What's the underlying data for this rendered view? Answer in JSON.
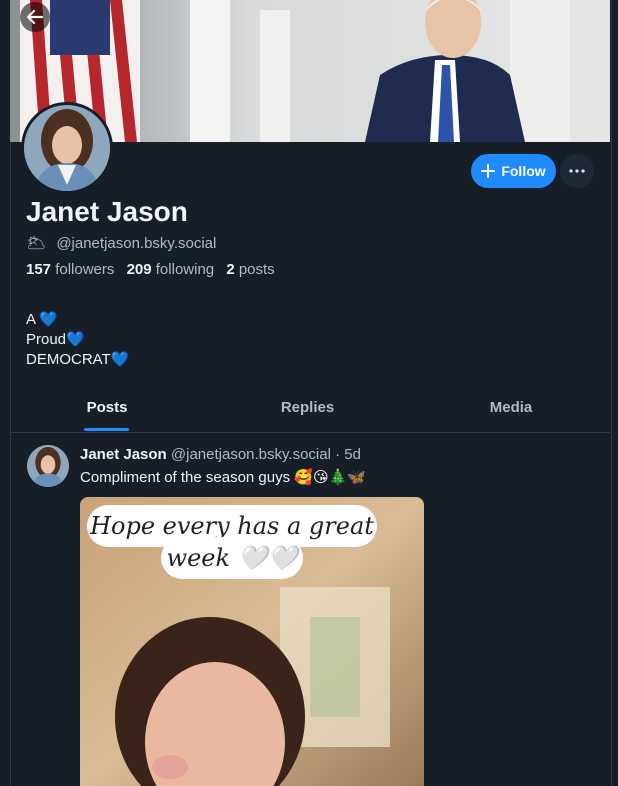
{
  "profile": {
    "display_name": "Janet Jason",
    "handle": "@janetjason.bsky.social",
    "handle_emoji": "🌥",
    "followers_count": "157",
    "followers_label": "followers",
    "following_count": "209",
    "following_label": "following",
    "posts_count": "2",
    "posts_label": "posts",
    "bio_lines": [
      "A 💙",
      "Proud💙",
      "DEMOCRAT💙"
    ]
  },
  "actions": {
    "follow_label": "Follow",
    "more_label": "···"
  },
  "tabs": [
    {
      "label": "Posts",
      "active": true
    },
    {
      "label": "Replies",
      "active": false
    },
    {
      "label": "Media",
      "active": false
    }
  ],
  "post": {
    "author": "Janet Jason",
    "handle": "@janetjason.bsky.social",
    "age": "· 5d",
    "text": "Compliment of the season guys 🥰😘🎄🦋",
    "image_caption_line1": "Hope every has a great",
    "image_caption_line2": "week 🤍🤍"
  },
  "colors": {
    "background": "#161e27",
    "accent": "#208bfe",
    "muted_text": "#aebbc9"
  }
}
